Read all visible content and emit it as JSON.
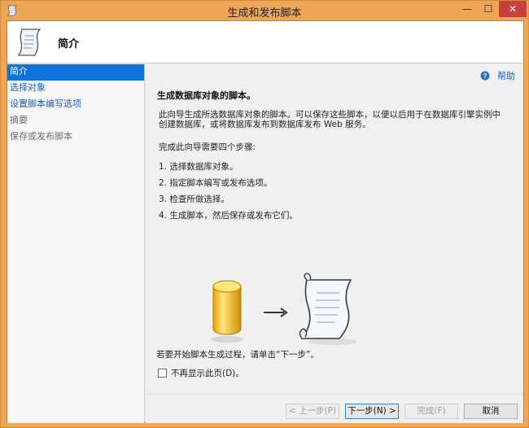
{
  "window": {
    "title": "生成和发布脚本"
  },
  "titlebar_buttons": {
    "minimize": "—",
    "maximize": "☐",
    "close": "✕"
  },
  "header": {
    "title": "简介"
  },
  "sidebar": {
    "items": [
      {
        "label": "简介",
        "state": "active"
      },
      {
        "label": "选择对象",
        "state": "link"
      },
      {
        "label": "设置脚本编写选项",
        "state": "link"
      },
      {
        "label": "摘要",
        "state": "disabled"
      },
      {
        "label": "保存或发布脚本",
        "state": "disabled"
      }
    ]
  },
  "main": {
    "help_label": "帮助",
    "section_title": "生成数据库对象的脚本。",
    "description": "此向导生成所选数据库对象的脚本。可以保存这些脚本，以便以后用于在数据库引擎实例中创建数据库，或将数据库发布到数据库发布 Web 服务。",
    "steps_intro": "完成此向导需要四个步骤:",
    "steps": [
      "1. 选择数据库对象。",
      " 2. 指定脚本编写或发布选项。",
      "3. 检查所做选择。",
      "4. 生成脚本，然后保存或发布它们。"
    ],
    "start_text": "若要开始脚本生成过程，请单击“下一步”。",
    "dont_show_label": "不再显示此页(D)。",
    "dont_show_checked": false
  },
  "buttons": {
    "prev": "< 上一步(P)",
    "next": "下一步(N) >",
    "finish": "完成(F)",
    "cancel": "取消"
  },
  "colors": {
    "title_bar": "#eea556",
    "accent": "#0c73d9",
    "link": "#1a5fb4",
    "close_button": "#c7403a"
  }
}
